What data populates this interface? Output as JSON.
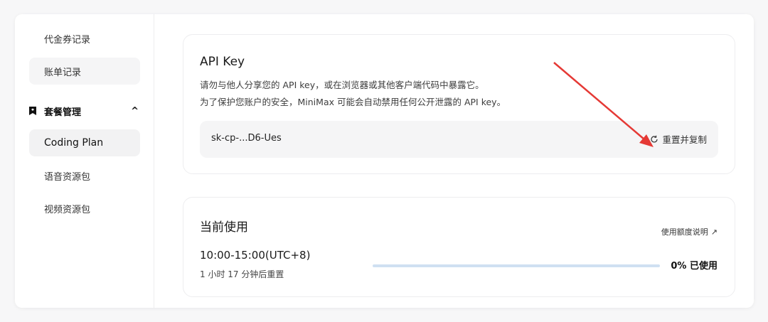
{
  "sidebar": {
    "items_top": [
      "代金券记录",
      "账单记录"
    ],
    "group": {
      "label": "套餐管理",
      "chevron": "^"
    },
    "items_group": [
      "Coding Plan",
      "语音资源包",
      "视频资源包"
    ]
  },
  "api_key": {
    "title": "API Key",
    "desc_line1": "请勿与他人分享您的 API key，或在浏览器或其他客户端代码中暴露它。",
    "desc_line2": "为了保护您账户的安全，MiniMax 可能会自动禁用任何公开泄露的 API key。",
    "masked_key": "sk-cp-...D6-Ues",
    "reset_label": "重置并复制"
  },
  "usage": {
    "title": "当前使用",
    "quota_link": "使用额度说明",
    "quota_link_arrow": "↗",
    "period": "10:00-15:00(UTC+8)",
    "reset_note": "1 小时 17 分钟后重置",
    "used_percent": 0,
    "used_label": "0% 已使用"
  },
  "colors": {
    "accent": "#4b8df8",
    "annotation_arrow": "#e53935"
  }
}
